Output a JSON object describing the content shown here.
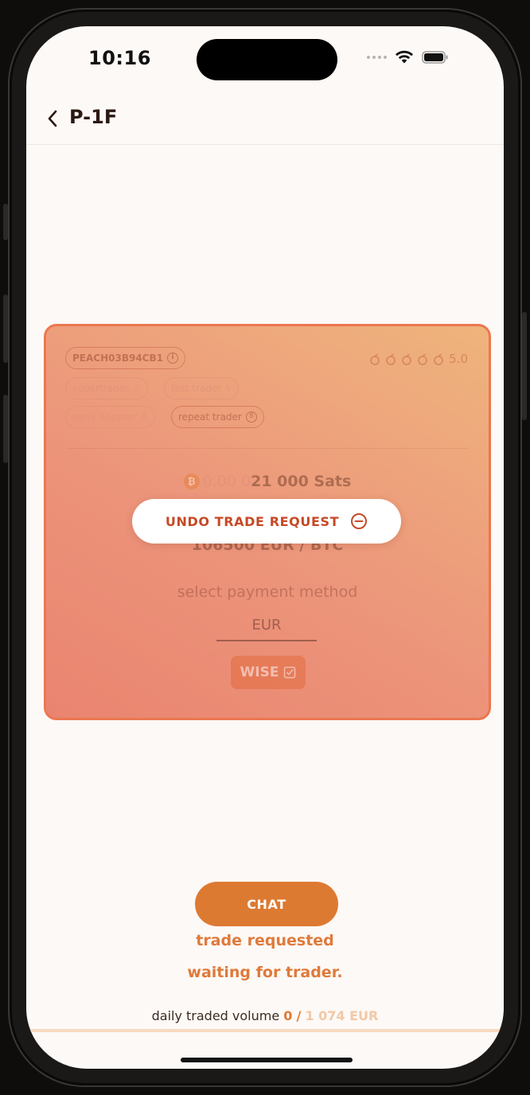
{
  "status_bar": {
    "time": "10:16"
  },
  "header": {
    "title": "P-1F"
  },
  "offer": {
    "peach_id": "PEACH03B94CB1",
    "rating": "5.0",
    "badges": [
      "supertrader",
      "fast trader",
      "early adopter",
      "repeat trader"
    ],
    "amount_btc_prefix": "0.00 0",
    "amount_sats": "21 000 Sats",
    "price": "106500 EUR / BTC",
    "select_payment_label": "select payment method",
    "currency": "EUR",
    "payment_method": "WISE"
  },
  "actions": {
    "undo_label": "UNDO TRADE REQUEST",
    "chat_label": "CHAT"
  },
  "status": {
    "line1": "trade requested",
    "line2": "waiting for trader."
  },
  "volume": {
    "label": "daily traded volume",
    "current": "0",
    "separator": "/",
    "max": "1 074 EUR"
  },
  "colors": {
    "accent": "#dd7a32",
    "background": "#fdf9f6",
    "card_border": "#ec7750"
  }
}
